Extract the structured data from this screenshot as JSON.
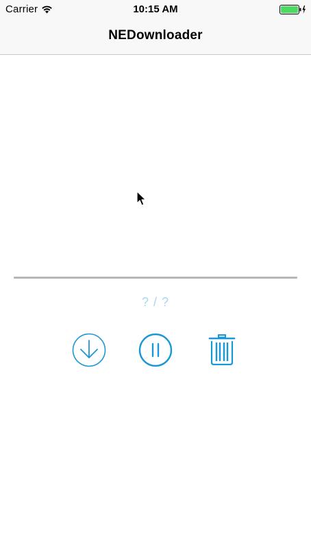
{
  "status_bar": {
    "carrier": "Carrier",
    "time": "10:15 AM",
    "battery_level": 1.0,
    "battery_color": "#4cd964"
  },
  "nav": {
    "title": "NEDownloader"
  },
  "download": {
    "progress": 0,
    "progress_text": "? / ?"
  },
  "controls": {
    "accent_color": "#1a97d6",
    "download_icon": "download-circle-icon",
    "pause_icon": "pause-circle-icon",
    "delete_icon": "trash-icon"
  }
}
